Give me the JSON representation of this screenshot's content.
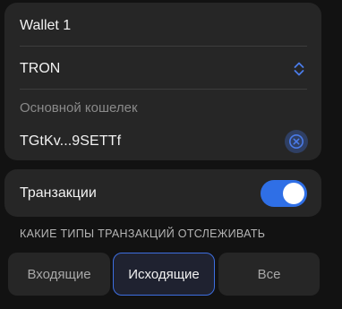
{
  "wallet": {
    "name": "Wallet 1",
    "network": "TRON",
    "main_wallet_label": "Основной кошелек",
    "address": "TGtKv...9SETTf"
  },
  "transactions": {
    "label": "Транзакции",
    "enabled": true
  },
  "filter": {
    "section_label": "КАКИЕ ТИПЫ ТРАНЗАКЦИЙ ОТСЛЕЖИВАТЬ",
    "options": [
      "Входящие",
      "Исходящие",
      "Все"
    ],
    "selected": "Исходящие"
  },
  "colors": {
    "accent": "#2f6fe6",
    "card": "#262626",
    "background": "#121212"
  },
  "icons": {
    "network_selector": "chevron-updown-icon",
    "clear_address": "close-circle-icon"
  }
}
